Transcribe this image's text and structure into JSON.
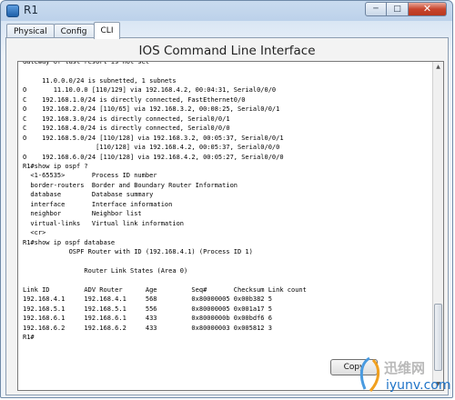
{
  "window": {
    "title": "R1",
    "controls": [
      "minimize",
      "maximize",
      "close"
    ]
  },
  "tabs": [
    {
      "label": "Physical",
      "active": false
    },
    {
      "label": "Config",
      "active": false
    },
    {
      "label": "CLI",
      "active": true
    }
  ],
  "panel": {
    "title": "IOS Command Line Interface"
  },
  "terminal": {
    "lines": [
      "Gateway of last resort is not set",
      "",
      "     11.0.0.0/24 is subnetted, 1 subnets",
      "O       11.10.0.0 [110/129] via 192.168.4.2, 00:04:31, Serial0/0/0",
      "C    192.168.1.0/24 is directly connected, FastEthernet0/0",
      "O    192.168.2.0/24 [110/65] via 192.168.3.2, 00:08:25, Serial0/0/1",
      "C    192.168.3.0/24 is directly connected, Serial0/0/1",
      "C    192.168.4.0/24 is directly connected, Serial0/0/0",
      "O    192.168.5.0/24 [110/128] via 192.168.3.2, 00:05:37, Serial0/0/1",
      "                   [110/128] via 192.168.4.2, 00:05:37, Serial0/0/0",
      "O    192.168.6.0/24 [110/128] via 192.168.4.2, 00:05:27, Serial0/0/0",
      "R1#show ip ospf ?",
      "  <1-65535>       Process ID number",
      "  border-routers  Border and Boundary Router Information",
      "  database        Database summary",
      "  interface       Interface information",
      "  neighbor        Neighbor list",
      "  virtual-links   Virtual link information",
      "  <cr>",
      "R1#show ip ospf database",
      "            OSPF Router with ID (192.168.4.1) (Process ID 1)",
      "",
      "                Router Link States (Area 0)",
      "",
      "Link ID         ADV Router      Age         Seq#       Checksum Link count",
      "192.168.4.1     192.168.4.1     568         0x80000005 0x00b382 5",
      "192.168.5.1     192.168.5.1     556         0x80000005 0x001a17 5",
      "192.168.6.1     192.168.6.1     433         0x8000000b 0x00bdf6 6",
      "192.168.6.2     192.168.6.2     433         0x80000003 0x005812 3",
      "R1#"
    ]
  },
  "buttons": {
    "copy": "Copy"
  },
  "watermark": {
    "cn": "迅维网",
    "url": "iyunv.com"
  }
}
